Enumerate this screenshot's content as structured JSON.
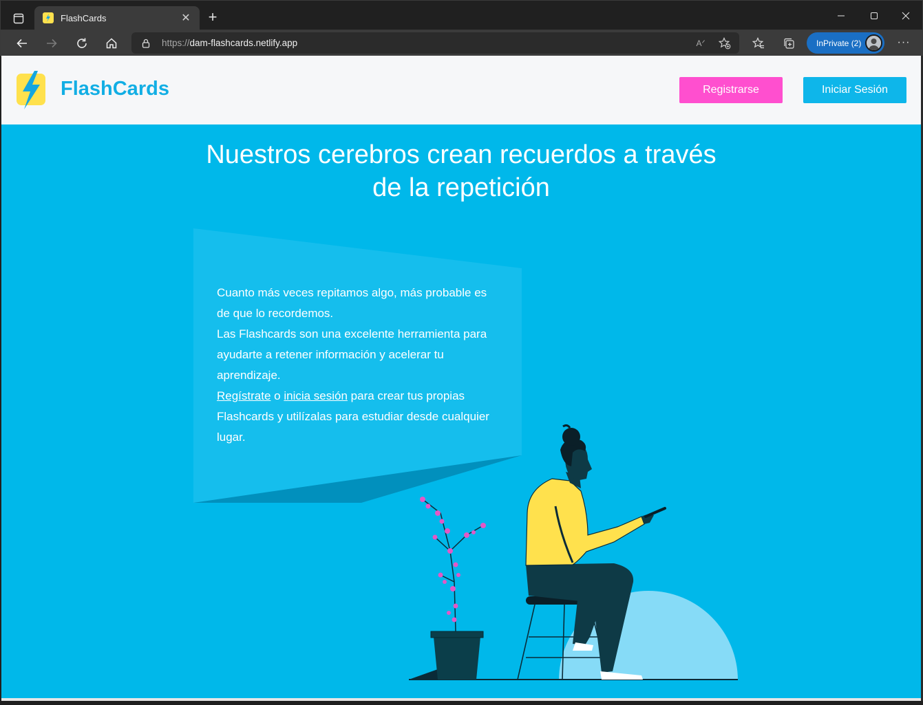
{
  "browser": {
    "tab_title": "FlashCards",
    "url_scheme": "https://",
    "url_host": "dam-flashcards.netlify.app",
    "inprivate_label": "InPrivate (2)",
    "read_aloud_label": "A"
  },
  "header": {
    "brand": "FlashCards",
    "register_label": "Registrarse",
    "login_label": "Iniciar Sesión"
  },
  "hero": {
    "title_line1": "Nuestros cerebros crean recuerdos a través",
    "title_line2": "de la repetición",
    "paragraph1": "Cuanto más veces repitamos algo, más probable es de que lo recordemos.",
    "paragraph2": "Las Flashcards son una excelente herramienta para ayudarte a retener información y acelerar tu aprendizaje.",
    "register_link": "Regístrate",
    "connector": " o ",
    "login_link": "inicia sesión",
    "paragraph3_rest": " para crear tus propias Flashcards y utilízalas para estudiar desde cualquier lugar."
  },
  "colors": {
    "hero_bg": "#00b8ea",
    "register_btn": "#ff4fcf",
    "login_btn": "#0eb6ea",
    "brand_text": "#12aee4",
    "logo_yellow": "#ffe14d"
  }
}
